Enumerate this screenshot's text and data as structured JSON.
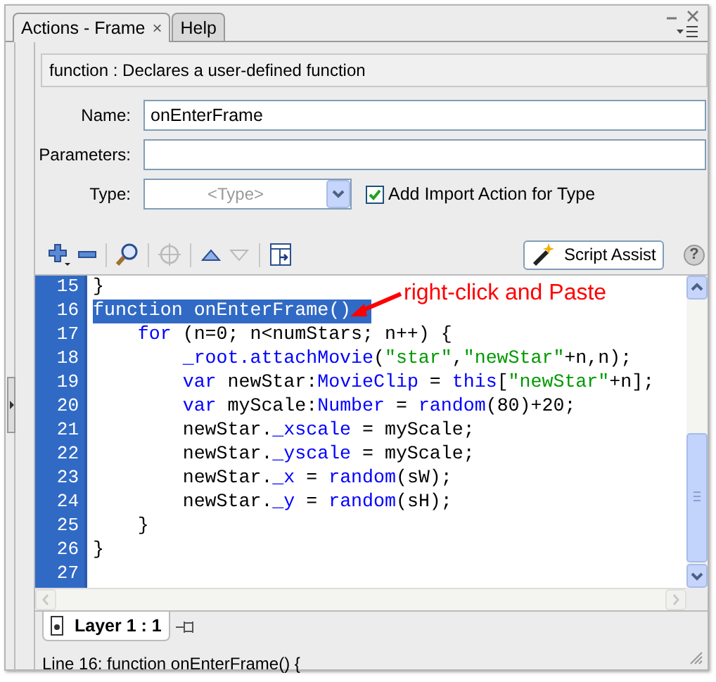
{
  "tabs": [
    {
      "label": "Actions - Frame",
      "selected": true,
      "close": "×"
    },
    {
      "label": "Help",
      "selected": false
    }
  ],
  "description": "function : Declares a user-defined function",
  "form": {
    "name": {
      "label": "Name:",
      "value": "onEnterFrame"
    },
    "parameters": {
      "label": "Parameters:"
    },
    "type": {
      "label": "Type:",
      "placeholder": "<Type>"
    },
    "import_action": {
      "label": "Add Import Action for Type",
      "checked": true
    }
  },
  "toolbar": {
    "script_assist": "Script Assist",
    "help": "?"
  },
  "code": {
    "lines": [
      {
        "number": "15",
        "selected": false,
        "tokens": [
          {
            "text": "}",
            "kind": "plain"
          }
        ]
      },
      {
        "number": "16",
        "selected": true,
        "tokens": [
          {
            "text": "function",
            "kind": "keyword"
          },
          {
            "text": " onEnterFrame()",
            "kind": "plain"
          }
        ]
      },
      {
        "number": "17",
        "selected": false,
        "tokens": [
          {
            "text": "    for",
            "kind": "keyword"
          },
          {
            "text": " (n=0; n<numStars; n++) {",
            "kind": "plain"
          }
        ]
      },
      {
        "number": "18",
        "selected": false,
        "tokens": [
          {
            "text": "        _root.attachMovie",
            "kind": "keyword"
          },
          {
            "text": "(",
            "kind": "plain"
          },
          {
            "text": "\"star\"",
            "kind": "string"
          },
          {
            "text": ",",
            "kind": "plain"
          },
          {
            "text": "\"newStar\"",
            "kind": "string"
          },
          {
            "text": "+n,n);",
            "kind": "plain"
          }
        ]
      },
      {
        "number": "19",
        "selected": false,
        "tokens": [
          {
            "text": "        var",
            "kind": "keyword"
          },
          {
            "text": " newStar:",
            "kind": "plain"
          },
          {
            "text": "MovieClip",
            "kind": "keyword"
          },
          {
            "text": " = ",
            "kind": "plain"
          },
          {
            "text": "this",
            "kind": "keyword"
          },
          {
            "text": "[",
            "kind": "plain"
          },
          {
            "text": "\"newStar\"",
            "kind": "string"
          },
          {
            "text": "+n];",
            "kind": "plain"
          }
        ]
      },
      {
        "number": "20",
        "selected": false,
        "tokens": [
          {
            "text": "        var",
            "kind": "keyword"
          },
          {
            "text": " myScale:",
            "kind": "plain"
          },
          {
            "text": "Number",
            "kind": "keyword"
          },
          {
            "text": " = ",
            "kind": "plain"
          },
          {
            "text": "random",
            "kind": "keyword"
          },
          {
            "text": "(80)+20;",
            "kind": "plain"
          }
        ]
      },
      {
        "number": "21",
        "selected": false,
        "tokens": [
          {
            "text": "        newStar.",
            "kind": "plain"
          },
          {
            "text": "_xscale",
            "kind": "keyword"
          },
          {
            "text": " = myScale;",
            "kind": "plain"
          }
        ]
      },
      {
        "number": "22",
        "selected": false,
        "tokens": [
          {
            "text": "        newStar.",
            "kind": "plain"
          },
          {
            "text": "_yscale",
            "kind": "keyword"
          },
          {
            "text": " = myScale;",
            "kind": "plain"
          }
        ]
      },
      {
        "number": "23",
        "selected": false,
        "tokens": [
          {
            "text": "        newStar.",
            "kind": "plain"
          },
          {
            "text": "_x",
            "kind": "keyword"
          },
          {
            "text": " = ",
            "kind": "plain"
          },
          {
            "text": "random",
            "kind": "keyword"
          },
          {
            "text": "(sW);",
            "kind": "plain"
          }
        ]
      },
      {
        "number": "24",
        "selected": false,
        "tokens": [
          {
            "text": "        newStar.",
            "kind": "plain"
          },
          {
            "text": "_y",
            "kind": "keyword"
          },
          {
            "text": " = ",
            "kind": "plain"
          },
          {
            "text": "random",
            "kind": "keyword"
          },
          {
            "text": "(sH);",
            "kind": "plain"
          }
        ]
      },
      {
        "number": "25",
        "selected": false,
        "tokens": [
          {
            "text": "    }",
            "kind": "plain"
          }
        ]
      },
      {
        "number": "26",
        "selected": false,
        "tokens": [
          {
            "text": "}",
            "kind": "plain"
          }
        ]
      },
      {
        "number": "27",
        "selected": false
      }
    ]
  },
  "annotation": "right-click and Paste",
  "layer_tab": "Layer 1 : 1",
  "status_bar": "Line 16: function onEnterFrame() {"
}
